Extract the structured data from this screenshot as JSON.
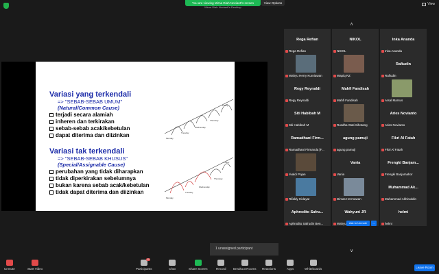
{
  "banner": {
    "text": "You are viewing Mirna Diah Novianti's screen",
    "sub": "Mirna Diah Novianti's Desktop",
    "view_options": "View Options",
    "view": "View"
  },
  "slide": {
    "section1": {
      "title": "Variasi yang terkendali",
      "sub": "=> \"SEBAB-SEBAB UMUM\"",
      "sub2": "(Natural/Common Cause)",
      "bullets": [
        "terjadi secara alamiah",
        "inheren dan terkirakan",
        "sebab-sebab acak/kebetulan",
        "dapat diterima dan diizinkan"
      ]
    },
    "section2": {
      "title": "Variasi tak terkendali",
      "sub": "=> \"SEBAB-SEBAB KHUSUS\"",
      "sub2": "(Special/Assignable Cause)",
      "bullets": [
        "perubahan yang tidak diharapkan",
        "tidak diperkirakan sebelumnya",
        "bukan karena sebab acak/kebetulan",
        "tidak dapat diterima dan diizinkan"
      ]
    },
    "diagram1_labels": [
      "Monday",
      "Tuesday",
      "Wednesday",
      "Thursday",
      "Friday"
    ],
    "diagram2_labels": [
      "Monday",
      "Tuesday",
      "Wednesday",
      "Thursday",
      "Friday"
    ]
  },
  "gallery": {
    "tiles": [
      {
        "name": "Rega Refian",
        "label": "Rega Refian",
        "photo": false
      },
      {
        "name": "NIKOL",
        "label": "NIKOL",
        "photo": false
      },
      {
        "name": "Inka Ananda",
        "label": "Inka Ananda",
        "photo": false
      },
      {
        "name": "",
        "label": "Wahyu Herry Kurniawan",
        "photo": true,
        "color": "#5a6d7a"
      },
      {
        "name": "",
        "label": "Wapiq RZ",
        "photo": true,
        "color": "#7a5c4e"
      },
      {
        "name": "Rafiudin",
        "label": "Rafiudin",
        "photo": false
      },
      {
        "name": "Regy Reynaldi",
        "label": "Regy Reynaldi",
        "photo": false
      },
      {
        "name": "Mahfi Fandisah",
        "label": "Mahfi Fandisah",
        "photo": false
      },
      {
        "name": "",
        "label": "Arsal Marsus",
        "photo": true,
        "color": "#8a9a6a"
      },
      {
        "name": "Siti Habibah M",
        "label": "Siti Habibah M",
        "photo": false
      },
      {
        "name": "",
        "label": "Rusdha Wati Sihotang",
        "photo": true,
        "color": "#6a5a4a"
      },
      {
        "name": "Aries Novianto",
        "label": "Aries Novianto",
        "photo": false
      },
      {
        "name": "Ramadhani Firm...",
        "label": "Ramadhani Firmanda [F...",
        "photo": false
      },
      {
        "name": "agung pamuji",
        "label": "agung pamuji",
        "photo": false
      },
      {
        "name": "Fikri Al Fatah",
        "label": "Fikri Al Fatah",
        "photo": false
      },
      {
        "name": "",
        "label": "rivaldi Pojan",
        "photo": true,
        "color": "#5a4a3a"
      },
      {
        "name": "Vania",
        "label": "Vania",
        "photo": false
      },
      {
        "name": "Frengki Banjam...",
        "label": "Frengki Banjamahor",
        "photo": false
      },
      {
        "name": "",
        "label": "Rifaldy Hidayat",
        "photo": true,
        "color": "#4a7aa0"
      },
      {
        "name": "",
        "label": "Dimas Hermawan",
        "photo": true,
        "color": "#7a8a9a"
      },
      {
        "name": "Muhammad Ak...",
        "label": "Muhammad Akhiruddin",
        "photo": false
      },
      {
        "name": "Aphrodito Safru...",
        "label": "Aphrodito Safrudin Ben...",
        "photo": false
      },
      {
        "name": "Wahyuni JR",
        "label": "Wahyuni JR",
        "photo": false
      },
      {
        "name": "helmi",
        "label": "helmi",
        "photo": false
      }
    ],
    "ask_unmute": "Ask to Unmute",
    "more": "..."
  },
  "unassigned": "1 unassigned participant",
  "toolbar": {
    "unmute": "Unmute",
    "video": "Start Video",
    "participants": "Participants",
    "participants_count": "55",
    "chat": "Chat",
    "share": "Share Screen",
    "record": "Record",
    "breakout": "Breakout Rooms",
    "reactions": "Reactions",
    "apps": "Apps",
    "whiteboards": "Whiteboards",
    "leave": "Leave Room"
  }
}
